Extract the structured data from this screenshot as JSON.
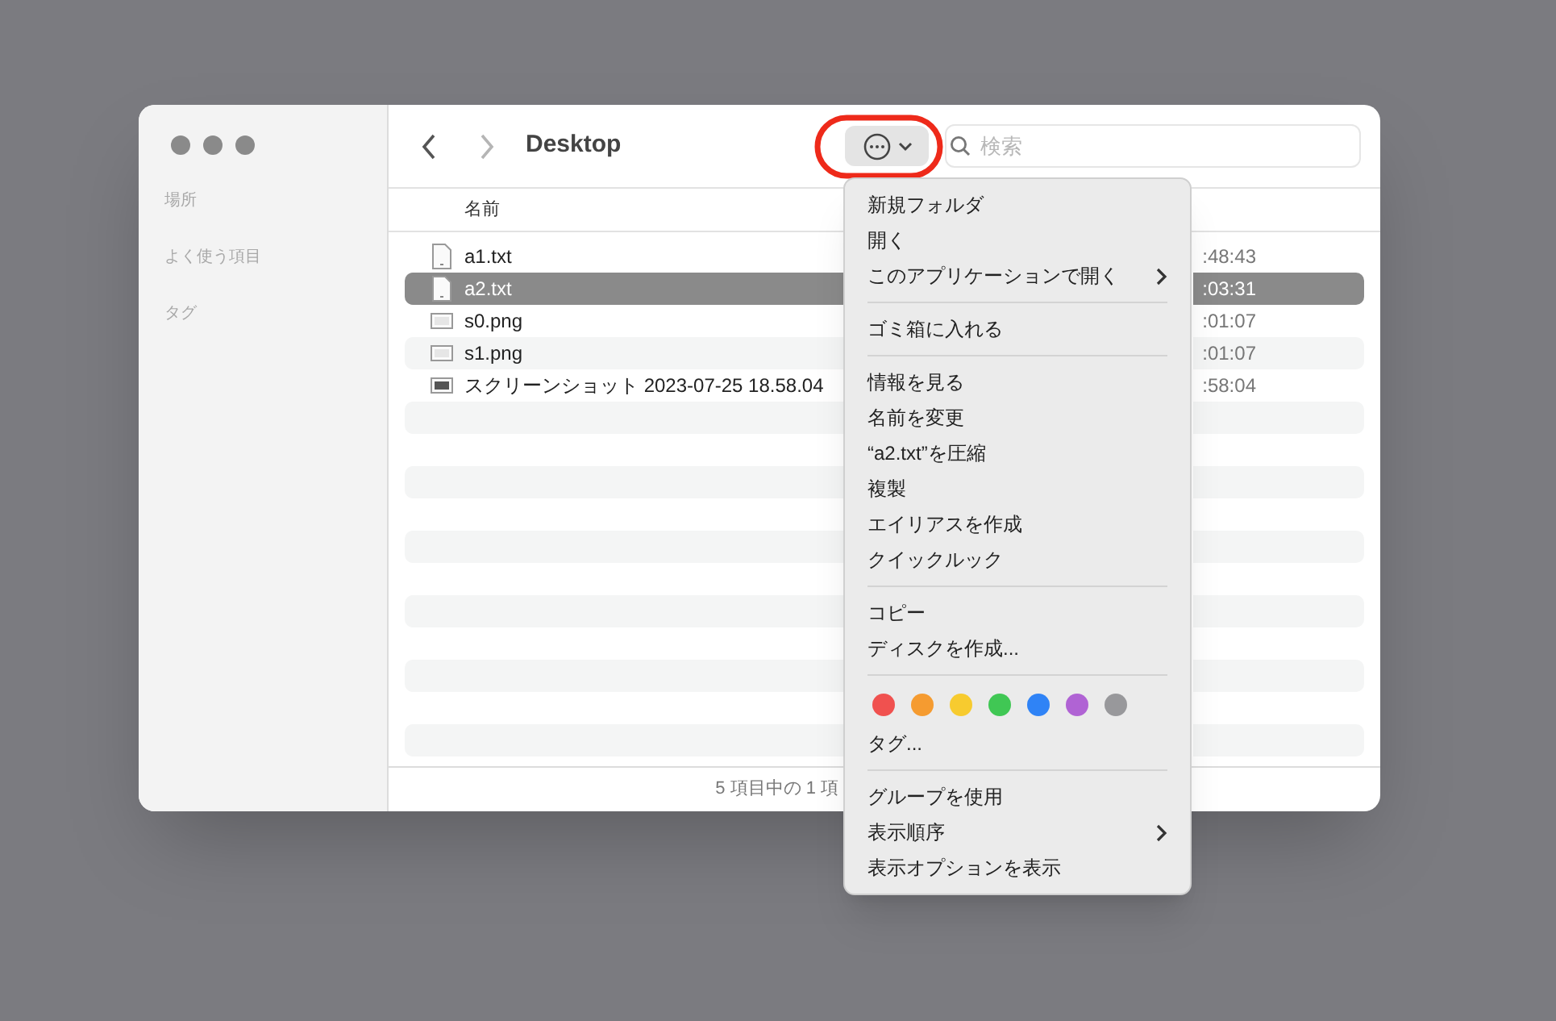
{
  "window": {
    "title": "Desktop"
  },
  "sidebar": {
    "sections": [
      "場所",
      "よく使う項目",
      "タグ"
    ]
  },
  "search": {
    "placeholder": "検索"
  },
  "table": {
    "columns": [
      "名前"
    ],
    "rows": [
      {
        "name": "a1.txt",
        "kind": "text",
        "time": ":48:43",
        "selected": false
      },
      {
        "name": "a2.txt",
        "kind": "text",
        "time": ":03:31",
        "selected": true
      },
      {
        "name": "s0.png",
        "kind": "image",
        "time": ":01:07",
        "selected": false
      },
      {
        "name": "s1.png",
        "kind": "image",
        "time": ":01:07",
        "selected": false
      },
      {
        "name": "スクリーンショット 2023-07-25 18.58.04",
        "kind": "screenshot",
        "time": ":58:04",
        "selected": false
      }
    ]
  },
  "status_bar": "5 項目中の 1 項",
  "menu": {
    "items": [
      {
        "kind": "item",
        "label": "新規フォルダ",
        "submenu": false
      },
      {
        "kind": "item",
        "label": "開く",
        "submenu": false
      },
      {
        "kind": "item",
        "label": "このアプリケーションで開く",
        "submenu": true
      },
      {
        "kind": "separator"
      },
      {
        "kind": "item",
        "label": "ゴミ箱に入れる",
        "submenu": false
      },
      {
        "kind": "separator"
      },
      {
        "kind": "item",
        "label": "情報を見る",
        "submenu": false
      },
      {
        "kind": "item",
        "label": "名前を変更",
        "submenu": false
      },
      {
        "kind": "item",
        "label": "“a2.txt”を圧縮",
        "submenu": false
      },
      {
        "kind": "item",
        "label": "複製",
        "submenu": false
      },
      {
        "kind": "item",
        "label": "エイリアスを作成",
        "submenu": false
      },
      {
        "kind": "item",
        "label": "クイックルック",
        "submenu": false
      },
      {
        "kind": "separator"
      },
      {
        "kind": "item",
        "label": "コピー",
        "submenu": false
      },
      {
        "kind": "item",
        "label": "ディスクを作成...",
        "submenu": false
      },
      {
        "kind": "separator"
      },
      {
        "kind": "tags",
        "colors": [
          {
            "color": "#f0514f"
          },
          {
            "color": "#f59b30"
          },
          {
            "color": "#f7cb2f"
          },
          {
            "color": "#40c754"
          },
          {
            "color": "#2f83f6"
          },
          {
            "color": "#b063d4"
          },
          {
            "color": "#98989b"
          }
        ]
      },
      {
        "kind": "item",
        "label": "タグ...",
        "submenu": false
      },
      {
        "kind": "separator"
      },
      {
        "kind": "item",
        "label": "グループを使用",
        "submenu": false
      },
      {
        "kind": "item",
        "label": "表示順序",
        "submenu": true
      },
      {
        "kind": "item",
        "label": "表示オプションを表示",
        "submenu": false
      }
    ]
  }
}
